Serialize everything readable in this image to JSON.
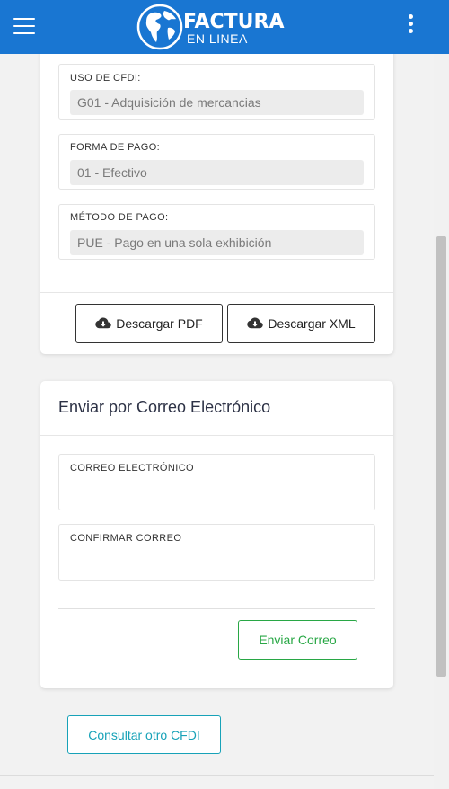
{
  "header": {
    "logo_title": "FACTURA",
    "logo_subtitle": "EN LINEA",
    "menu_icon": "hamburger-menu-icon",
    "more_icon": "more-vertical-icon",
    "bar_color": "#1976d2"
  },
  "invoice": {
    "uso_cfdi": {
      "label": "USO DE CFDI:",
      "value": "G01 - Adquisición de mercancias"
    },
    "forma_pago": {
      "label": "FORMA DE PAGO:",
      "value": "01 - Efectivo"
    },
    "metodo_pago": {
      "label": "MÉTODO DE PAGO:",
      "value": "PUE - Pago en una sola exhibición"
    },
    "download_pdf": "Descargar PDF",
    "download_xml": "Descargar XML",
    "download_icon": "cloud-download-icon"
  },
  "email": {
    "title": "Enviar por Correo Electrónico",
    "email_label": "CORREO ELECTRÓNICO",
    "confirm_label": "CONFIRMAR CORREO",
    "send_button": "Enviar Correo",
    "send_color": "#28a745"
  },
  "footer": {
    "consult_button": "Consultar otro CFDI",
    "consult_color": "#17a2b8"
  }
}
